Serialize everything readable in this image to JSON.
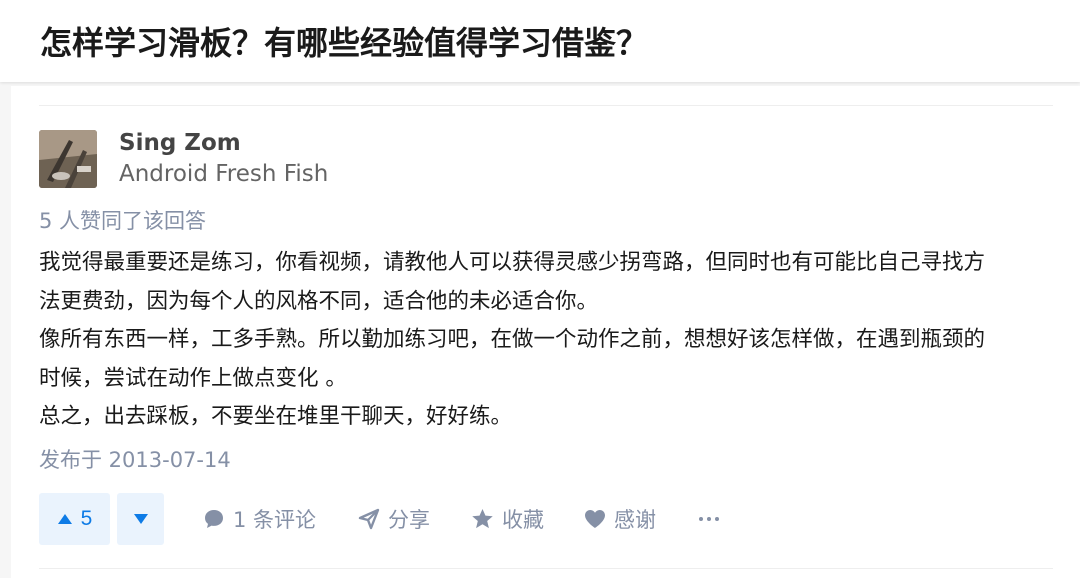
{
  "question": {
    "title": "怎样学习滑板？有哪些经验值得学习借鉴？"
  },
  "answer": {
    "author": {
      "name": "Sing Zom",
      "bio": "Android Fresh Fish"
    },
    "votes_summary": "5 人赞同了该回答",
    "paragraphs": [
      "我觉得最重要还是练习，你看视频，请教他人可以获得灵感少拐弯路，但同时也有可能比自己寻找方",
      "法更费劲，因为每个人的风格不同，适合他的未必适合你。",
      "像所有东西一样，工多手熟。所以勤加练习吧，在做一个动作之前，想想好该怎样做，在遇到瓶颈的",
      "时候，尝试在动作上做点变化 。",
      "总之，出去踩板，不要坐在堆里干聊天，好好练。"
    ],
    "publish_date": "发布于 2013-07-14",
    "actions": {
      "upvote_count": "5",
      "comment_label": "1 条评论",
      "share_label": "分享",
      "collect_label": "收藏",
      "thanks_label": "感谢"
    }
  },
  "colors": {
    "accent": "#0e7be6",
    "accent_bg": "#eaf3fd",
    "meta_text": "#8590a6",
    "page_bg": "#f6f6f6"
  },
  "icons": [
    "triangle-up-icon",
    "triangle-down-icon",
    "comment-bubble-icon",
    "paper-plane-icon",
    "star-icon",
    "heart-icon",
    "more-dots-icon"
  ]
}
